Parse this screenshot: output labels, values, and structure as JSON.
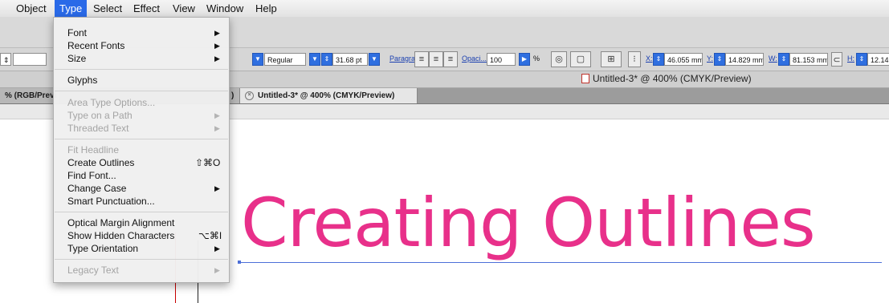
{
  "menubar": {
    "items": [
      "Object",
      "Type",
      "Select",
      "Effect",
      "View",
      "Window",
      "Help"
    ]
  },
  "type_menu": {
    "items": [
      {
        "label": "Font",
        "submenu": true,
        "enabled": true
      },
      {
        "label": "Recent Fonts",
        "submenu": true,
        "enabled": true
      },
      {
        "label": "Size",
        "submenu": true,
        "enabled": true
      },
      {
        "label": "Glyphs",
        "enabled": true
      },
      {
        "label": "Area Type Options...",
        "enabled": false
      },
      {
        "label": "Type on a Path",
        "submenu": true,
        "enabled": false
      },
      {
        "label": "Threaded Text",
        "submenu": true,
        "enabled": false
      },
      {
        "label": "Fit Headline",
        "enabled": false
      },
      {
        "label": "Create Outlines",
        "shortcut": "⇧⌘O",
        "enabled": true
      },
      {
        "label": "Find Font...",
        "enabled": true
      },
      {
        "label": "Change Case",
        "submenu": true,
        "enabled": true
      },
      {
        "label": "Smart Punctuation...",
        "enabled": true
      },
      {
        "label": "Optical Margin Alignment",
        "enabled": true
      },
      {
        "label": "Show Hidden Characters",
        "shortcut": "⌥⌘I",
        "enabled": true
      },
      {
        "label": "Type Orientation",
        "submenu": true,
        "enabled": true
      },
      {
        "label": "Legacy Text",
        "submenu": true,
        "enabled": false
      }
    ]
  },
  "control_bar": {
    "font_style": "Regular",
    "font_size": "31.68 pt",
    "paragraph_link": "Paragra...",
    "opacity_link": "Opaci...",
    "opacity_value": "100",
    "opacity_unit": "%",
    "x_label": "X:",
    "x_value": "46.055 mm",
    "y_label": "Y:",
    "y_value": "14.829 mm",
    "w_label": "W:",
    "w_value": "81.153 mm",
    "h_label": "H:",
    "h_value": "12.14"
  },
  "window_title": "Untitled-3* @ 400% (CMYK/Preview)",
  "tabs": [
    {
      "label": "% (RGB/Previ",
      "active": false
    },
    {
      "label": ")",
      "active": false
    },
    {
      "label": "Untitled-3* @ 400% (CMYK/Preview)",
      "active": true,
      "close_icon": "close-circle-icon"
    }
  ],
  "canvas": {
    "headline": "Creating Outlines",
    "headline_color": "#e8308a",
    "baseline_color": "#4d6fd8"
  },
  "colors": {
    "menu_highlight": "#2a6ae8"
  }
}
